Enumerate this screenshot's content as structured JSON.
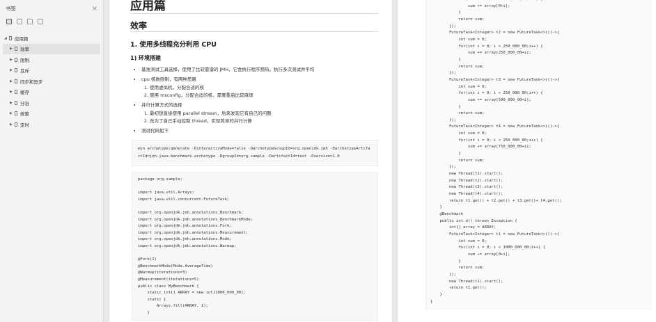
{
  "sidebar": {
    "title": "书签",
    "close_icon": "×",
    "tools": [
      "bookmark-grid-icon",
      "bookmark-add-icon",
      "bookmark-remove-icon",
      "bookmark-more-icon"
    ],
    "root": {
      "label": "应用篇"
    },
    "items": [
      {
        "label": "效率"
      },
      {
        "label": "限制"
      },
      {
        "label": "互斥"
      },
      {
        "label": "同步和异步"
      },
      {
        "label": "缓存"
      },
      {
        "label": "分治"
      },
      {
        "label": "统筹"
      },
      {
        "label": "定时"
      }
    ]
  },
  "doc": {
    "h1": "应用篇",
    "h2": "效率",
    "h3": "1. 使用多线程充分利用 CPU",
    "h4": "1) 环境搭建",
    "bullets": {
      "b1": "基准测试工具选择，使用了比较靠谱的 JMH，它会执行程序预热，执行多次测试并平均",
      "b2": "cpu 核数限制，有两种思路",
      "b2_sub": [
        "使用虚拟机，分配合适的核",
        "使用 msconfig，分配合适的核，需要重启比较麻烦"
      ],
      "b3": "并行计算方式的选择",
      "b3_sub": [
        "最初想直接使用 parallel stream，后来发现它有自己的问题",
        "改为了自己手动控制 thread，实现简单的并行计算"
      ],
      "b4": "测试代码如下"
    },
    "mvn_command": "mvn archetype:generate -DinteractiveMode=false -DarchetypeGroupId=org.openjdk.jmh -DarchetypeArtifactId=jmh-java-benchmark-archetype -DgroupId=org.sample -DartifactId=test -Dversion=1.0",
    "code_left": "package org.sample;\n\nimport java.util.Arrays;\nimport java.util.concurrent.FutureTask;\n\nimport org.openjdk.jmh.annotations.Benchmark;\nimport org.openjdk.jmh.annotations.BenchmarkMode;\nimport org.openjdk.jmh.annotations.Fork;\nimport org.openjdk.jmh.annotations.Measurement;\nimport org.openjdk.jmh.annotations.Mode;\nimport org.openjdk.jmh.annotations.Warmup;\n\n@Fork(1)\n@BenchmarkMode(Mode.AverageTime)\n@Warmup(iterations=3)\n@Measurement(iterations=5)\npublic class MyBenchmark {\n    static int[] ARRAY = new int[1000_000_00];\n    static {\n        Arrays.fill(ARRAY, 1);\n    }",
    "code_right": "            for(int i = 0; i < 250_000_00;i++) {\n                sum += array[0+i];\n            }\n            return sum;\n        });\n        FutureTask<Integer> t2 = new FutureTask<>(()->{\n            int sum = 0;\n            for(int i = 0; i < 250_000_00;i++) {\n                sum += array[250_000_00+i];\n            }\n            return sum;\n        });\n        FutureTask<Integer> t3 = new FutureTask<>(()->{\n            int sum = 0;\n            for(int i = 0; i < 250_000_00;i++) {\n                sum += array[500_000_00+i];\n            }\n            return sum;\n        });\n        FutureTask<Integer> t4 = new FutureTask<>(()->{\n            int sum = 0;\n            for(int i = 0; i < 250_000_00;i++) {\n                sum += array[750_000_00+i];\n            }\n            return sum;\n        });\n        new Thread(t1).start();\n        new Thread(t2).start();\n        new Thread(t3).start();\n        new Thread(t4).start();\n        return t1.get() + t2.get() + t3.get()+ t4.get();\n    }\n    @Benchmark\n    public int d() throws Exception {\n        int[] array = ARRAY;\n        FutureTask<Integer> t1 = new FutureTask<>(()->{\n            int sum = 0;\n            for(int i = 0; i < 1000_000_00;i++) {\n                sum += array[0+i];\n            }\n            return sum;\n        });\n        new Thread(t1).start();\n        return t1.get();\n    }\n}"
  }
}
